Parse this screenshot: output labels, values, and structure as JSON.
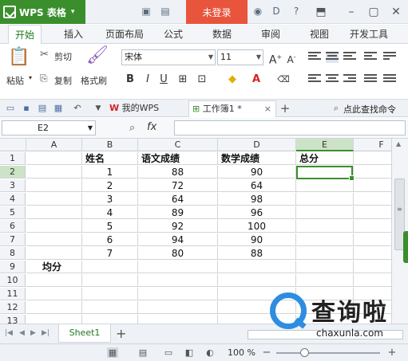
{
  "titlebar": {
    "app_name": "WPS 表格",
    "login_label": "未登录"
  },
  "menu": {
    "tabs": [
      "开始",
      "插入",
      "页面布局",
      "公式",
      "数据",
      "审阅",
      "视图",
      "开发工具"
    ]
  },
  "ribbon": {
    "paste": "粘贴",
    "cut": "剪切",
    "copy": "复制",
    "format_painter": "格式刷",
    "font_name": "宋体",
    "font_size": "11",
    "bold": "B",
    "italic": "I",
    "underline": "U"
  },
  "docbar": {
    "my_wps": "我的WPS",
    "workbook": "工作簿1 *",
    "search": "点此查找命令"
  },
  "formula_bar": {
    "cell_ref": "E2",
    "fx_label": "fx",
    "formula": ""
  },
  "sheet": {
    "columns": [
      "A",
      "B",
      "C",
      "D",
      "E",
      "F"
    ],
    "rows": [
      "1",
      "2",
      "3",
      "4",
      "5",
      "6",
      "7",
      "8",
      "9",
      "10",
      "11",
      "12",
      "13"
    ],
    "headers": {
      "B": "姓名",
      "C": "语文成绩",
      "D": "数学成绩",
      "E": "总分"
    },
    "data": [
      {
        "name": "1",
        "chinese": "88",
        "math": "90"
      },
      {
        "name": "2",
        "chinese": "72",
        "math": "64"
      },
      {
        "name": "3",
        "chinese": "64",
        "math": "98"
      },
      {
        "name": "4",
        "chinese": "89",
        "math": "96"
      },
      {
        "name": "5",
        "chinese": "92",
        "math": "100"
      },
      {
        "name": "6",
        "chinese": "94",
        "math": "90"
      },
      {
        "name": "7",
        "chinese": "80",
        "math": "88"
      }
    ],
    "average_label": "均分",
    "active_cell": "E2"
  },
  "sheetbar": {
    "sheet_name": "Sheet1"
  },
  "status": {
    "zoom": "100 %"
  },
  "watermark": {
    "text": "查询啦",
    "url": "chaxunla.com"
  },
  "colors": {
    "brand_green": "#3a8f2c",
    "login_red": "#e8553c",
    "watermark_blue": "#2e8de0"
  }
}
